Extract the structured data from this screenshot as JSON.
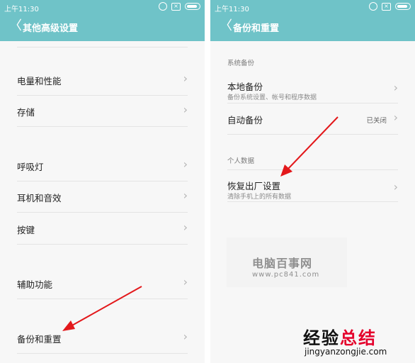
{
  "statusbar_time": "上午11:30",
  "statusbar_box": "×",
  "back_glyph": "〈",
  "chevron_glyph": "›",
  "left": {
    "title": "其他高级设置",
    "items": [
      {
        "label": "电量和性能"
      },
      {
        "label": "存储"
      },
      {
        "label": "呼吸灯"
      },
      {
        "label": "耳机和音效"
      },
      {
        "label": "按键"
      },
      {
        "label": "辅助功能"
      },
      {
        "label": "备份和重置"
      }
    ]
  },
  "right": {
    "title": "备份和重置",
    "section_system": "系统备份",
    "local_backup": {
      "label": "本地备份",
      "sub": "备份系统设置、帐号和程序数据"
    },
    "auto_backup": {
      "label": "自动备份",
      "value": "已关闭"
    },
    "section_personal": "个人数据",
    "factory_reset": {
      "label": "恢复出厂设置",
      "sub": "清除手机上的所有数据"
    }
  },
  "watermark_1": {
    "title": "电脑百事网",
    "url": "www.pc841.com"
  },
  "watermark_2": {
    "title_a": "经验",
    "title_b": "总结",
    "url": "jingyanzongjie.com"
  },
  "colors": {
    "header": "#6fc3c8",
    "arrow": "#e3181b",
    "background": "#f7f7f7"
  }
}
